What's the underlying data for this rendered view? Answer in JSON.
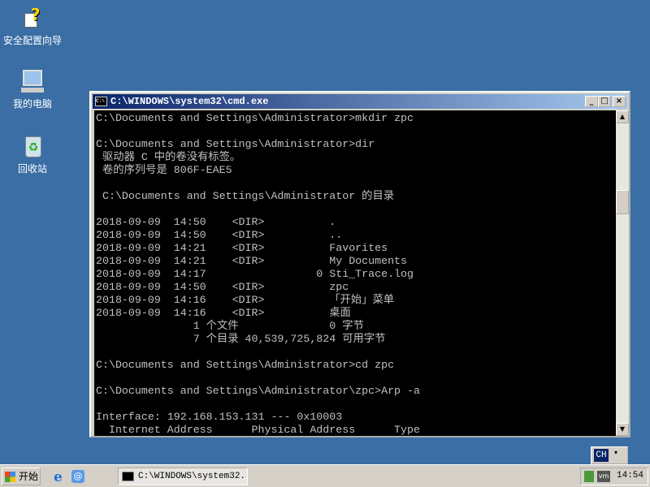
{
  "desktop": {
    "icons": [
      {
        "label": "安全配置向导",
        "icon": "security-wizard-icon"
      },
      {
        "label": "我的电脑",
        "icon": "computer-icon"
      },
      {
        "label": "回收站",
        "icon": "recycle-bin-icon"
      }
    ]
  },
  "window": {
    "title": "C:\\WINDOWS\\system32\\cmd.exe",
    "minimize": "_",
    "maximize": "□",
    "close": "×"
  },
  "console": {
    "lines": [
      "C:\\Documents and Settings\\Administrator>mkdir zpc",
      "",
      "C:\\Documents and Settings\\Administrator>dir",
      " 驱动器 C 中的卷没有标签。",
      " 卷的序列号是 806F-EAE5",
      "",
      " C:\\Documents and Settings\\Administrator 的目录",
      "",
      "2018-09-09  14:50    <DIR>          .",
      "2018-09-09  14:50    <DIR>          ..",
      "2018-09-09  14:21    <DIR>          Favorites",
      "2018-09-09  14:21    <DIR>          My Documents",
      "2018-09-09  14:17                 0 Sti_Trace.log",
      "2018-09-09  14:50    <DIR>          zpc",
      "2018-09-09  14:16    <DIR>          「开始」菜单",
      "2018-09-09  14:16    <DIR>          桌面",
      "               1 个文件              0 字节",
      "               7 个目录 40,539,725,824 可用字节",
      "",
      "C:\\Documents and Settings\\Administrator>cd zpc",
      "",
      "C:\\Documents and Settings\\Administrator\\zpc>Arp -a",
      "",
      "Interface: 192.168.153.131 --- 0x10003",
      "  Internet Address      Physical Address      Type"
    ]
  },
  "language_bar": {
    "label": "CH"
  },
  "taskbar": {
    "start_label": "开始",
    "task_label": "C:\\WINDOWS\\system32...",
    "clock": "14:54"
  }
}
